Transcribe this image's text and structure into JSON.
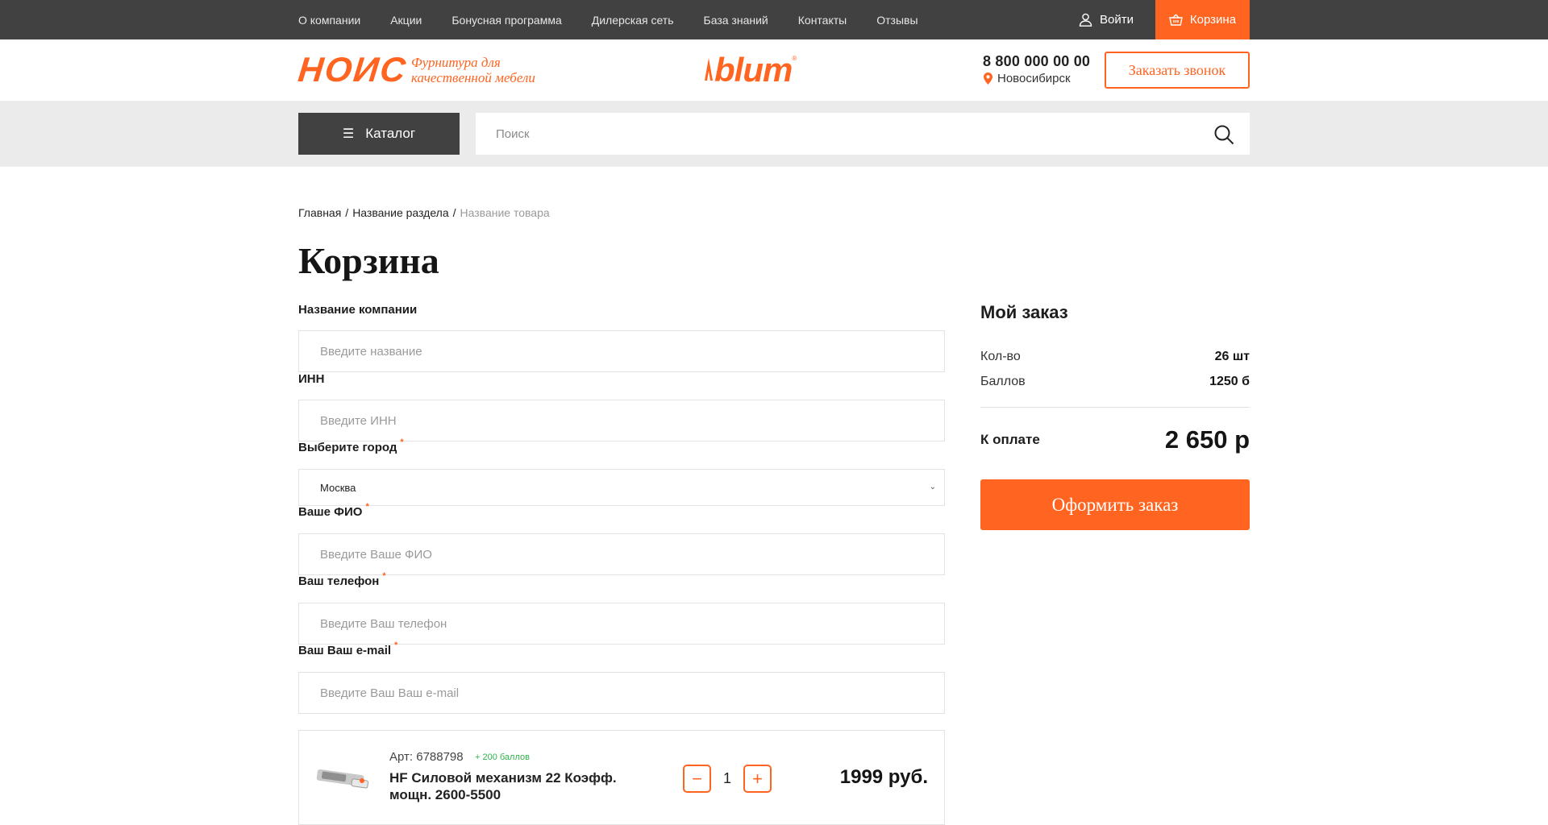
{
  "topnav": {
    "items": [
      "О компании",
      "Акции",
      "Бонусная программа",
      "Дилерская сеть",
      "База знаний",
      "Контакты",
      "Отзывы"
    ],
    "login_label": "Войти",
    "cart_label": "Корзина"
  },
  "header": {
    "logo_text": "НОИС",
    "tagline": "Фурнитура для качественной мебели",
    "brand_logo": "blum",
    "brand_reg": "®",
    "phone": "8 800 000 00 00",
    "city": "Новосибирск",
    "callback_label": "Заказать звонок"
  },
  "searchbar": {
    "catalog_label": "Каталог",
    "search_placeholder": "Поиск"
  },
  "breadcrumb": {
    "items": [
      "Главная",
      "Название раздела"
    ],
    "separator": "/",
    "current": "Название товара"
  },
  "page_title": "Корзина",
  "form": {
    "company_label": "Название компании",
    "company_placeholder": "Введите название",
    "inn_label": "ИНН",
    "inn_placeholder": "Введите ИНН",
    "city_label": "Выберите город",
    "city_value": "Москва",
    "fio_label": "Ваше ФИО",
    "fio_placeholder": "Введите Ваше ФИО",
    "phone_label": "Ваш телефон",
    "phone_placeholder": "Введите Ваш телефон",
    "email_label": "Ваш Ваш e-mail",
    "email_placeholder": "Введите Ваш Ваш e-mail",
    "required_mark": "*"
  },
  "product": {
    "article": "Арт: 6788798",
    "bonus": "+ 200 баллов",
    "name": "HF Силовой механизм 22 Коэфф. мощн. 2600-5500",
    "quantity": "1",
    "minus": "−",
    "plus": "+",
    "price": "1999 руб."
  },
  "summary": {
    "title": "Мой заказ",
    "qty_label": "Кол-во",
    "qty_value": "26 шт",
    "points_label": "Баллов",
    "points_value": "1250 б",
    "pay_label": "К оплате",
    "pay_value": "2 650 р",
    "order_button": "Оформить заказ"
  },
  "colors": {
    "accent": "#ff6420",
    "topbar": "#414141",
    "search_band": "#ebebeb",
    "bonus_green": "#2fb24c"
  }
}
